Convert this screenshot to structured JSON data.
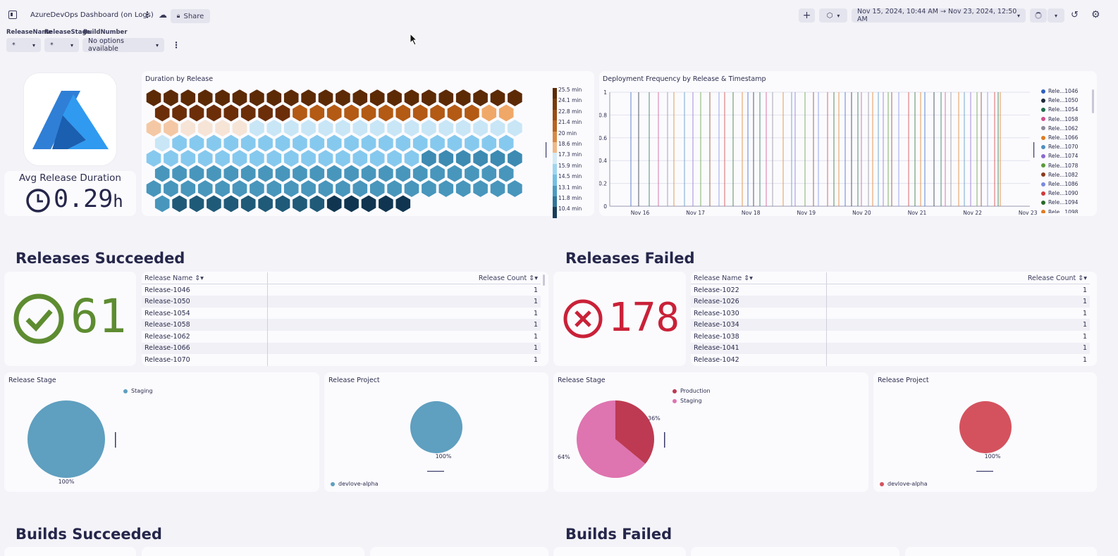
{
  "header": {
    "title": "AzureDevOps Dashboard (on Logs)",
    "share_label": "Share",
    "timeframe": "Nov 15, 2024, 10:44 AM → Nov 23, 2024, 12:50 AM",
    "icons": [
      "sidebar-toggle-icon",
      "more-vertical-icon",
      "cloud-icon",
      "lock-icon",
      "plus-icon",
      "package-icon",
      "chevron-down-icon",
      "loading-icon",
      "history-icon",
      "gear-icon"
    ]
  },
  "filters": [
    {
      "label": "ReleaseName",
      "value": "*"
    },
    {
      "label": "ReleaseStage",
      "value": "*"
    },
    {
      "label": "BuildNumber",
      "value": "No options available"
    }
  ],
  "avg_release": {
    "label": "Avg Release Duration",
    "value": "0.29",
    "unit": "h"
  },
  "duration_by_release": {
    "title": "Duration by Release",
    "legend": [
      "25.5 min",
      "24.1 min",
      "22.8 min",
      "21.4 min",
      "20 min",
      "18.6 min",
      "17.3 min",
      "15.9 min",
      "14.5 min",
      "13.1 min",
      "11.8 min",
      "10.4 min"
    ],
    "legend_colors": [
      "#5c2a05",
      "#7a3a0a",
      "#9a4c12",
      "#b9621e",
      "#d98a45",
      "#f0b888",
      "#d4ebf6",
      "#9fd6f0",
      "#74bfe3",
      "#4a9bc0",
      "#2f7698",
      "#163e58"
    ]
  },
  "deploy_freq": {
    "title": "Deployment Frequency by Release & Timestamp",
    "yticks": [
      "1",
      "0.8",
      "0.6",
      "0.4",
      "0.2",
      "0"
    ],
    "xticks": [
      "Nov 16",
      "Nov 17",
      "Nov 18",
      "Nov 19",
      "Nov 20",
      "Nov 21",
      "Nov 22",
      "Nov 23"
    ],
    "legend": [
      {
        "name": "Rele...1046",
        "color": "#2f5fbf"
      },
      {
        "name": "Rele...1050",
        "color": "#1d2a3a"
      },
      {
        "name": "Rele...1054",
        "color": "#1f6e4a"
      },
      {
        "name": "Rele...1058",
        "color": "#d04f8c"
      },
      {
        "name": "Rele...1062",
        "color": "#8a8a9a"
      },
      {
        "name": "Rele...1066",
        "color": "#e07b22"
      },
      {
        "name": "Rele...1070",
        "color": "#4f8fc0"
      },
      {
        "name": "Rele...1074",
        "color": "#8a6ad0"
      },
      {
        "name": "Rele...1078",
        "color": "#5a9a3a"
      },
      {
        "name": "Rele...1082",
        "color": "#8a3a1e"
      },
      {
        "name": "Rele...1086",
        "color": "#7a8ae0"
      },
      {
        "name": "Rele...1090",
        "color": "#d03a3a"
      },
      {
        "name": "Rele...1094",
        "color": "#2a6a2a"
      },
      {
        "name": "Rele...1098",
        "color": "#e07b22"
      }
    ]
  },
  "releases_succeeded": {
    "title": "Releases Succeeded",
    "count": "61",
    "columns": [
      "Release Name",
      "Release Count"
    ],
    "rows": [
      [
        "Release-1046",
        "1"
      ],
      [
        "Release-1050",
        "1"
      ],
      [
        "Release-1054",
        "1"
      ],
      [
        "Release-1058",
        "1"
      ],
      [
        "Release-1062",
        "1"
      ],
      [
        "Release-1066",
        "1"
      ],
      [
        "Release-1070",
        "1"
      ]
    ]
  },
  "releases_failed": {
    "title": "Releases Failed",
    "count": "178",
    "columns": [
      "Release Name",
      "Release Count"
    ],
    "rows": [
      [
        "Release-1022",
        "1"
      ],
      [
        "Release-1026",
        "1"
      ],
      [
        "Release-1030",
        "1"
      ],
      [
        "Release-1034",
        "1"
      ],
      [
        "Release-1038",
        "1"
      ],
      [
        "Release-1041",
        "1"
      ],
      [
        "Release-1042",
        "1"
      ]
    ]
  },
  "pies": {
    "succ_stage": {
      "title": "Release Stage",
      "legend": "Staging",
      "label": "100%",
      "color": "#5f9fbf"
    },
    "succ_project": {
      "title": "Release Project",
      "legend": "devlove-alpha",
      "label": "100%",
      "color": "#5f9fbf"
    },
    "fail_stage": {
      "title": "Release Stage",
      "legend": [
        "Production",
        "Staging"
      ],
      "labels": [
        "36%",
        "64%"
      ],
      "values": [
        36,
        64
      ],
      "colors": [
        "#bd3a52",
        "#de74b0"
      ]
    },
    "fail_project": {
      "title": "Release Project",
      "legend": "devlove-alpha",
      "label": "100%",
      "color": "#d4525e"
    }
  },
  "builds": {
    "succeeded_title": "Builds Succeeded",
    "failed_title": "Builds Failed"
  }
}
